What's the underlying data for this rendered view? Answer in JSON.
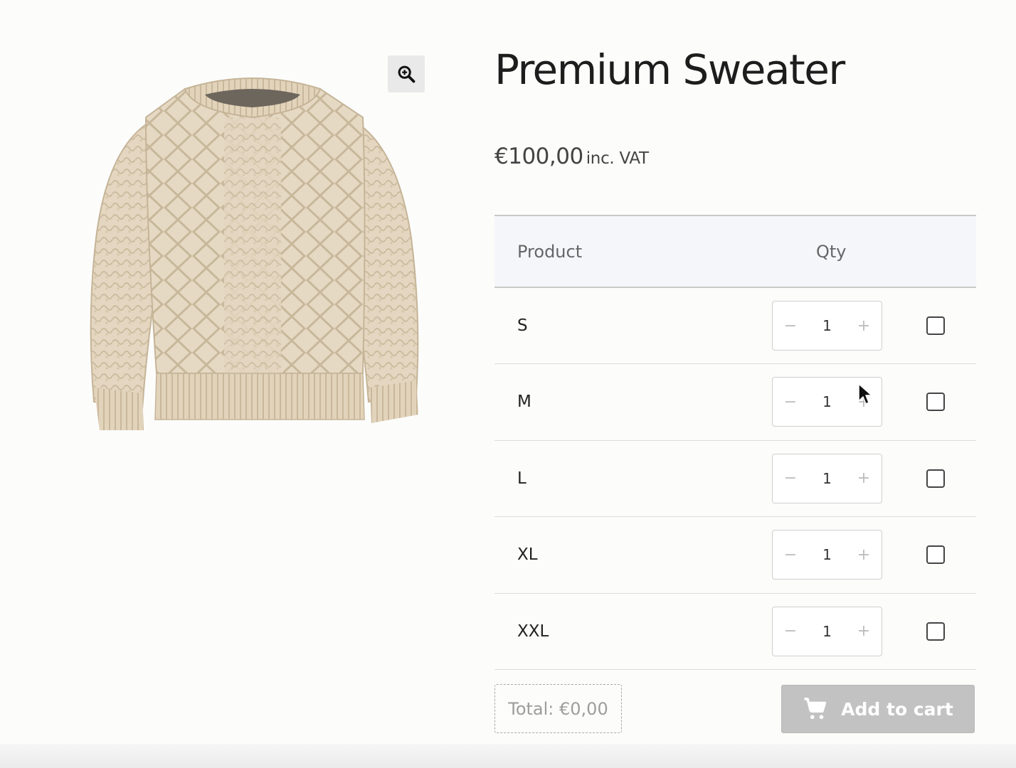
{
  "product": {
    "title": "Premium Sweater",
    "price": "€100,00",
    "price_suffix": "inc. VAT",
    "image_alt": "cream cable-knit sweater",
    "zoom_icon": "zoom-in-icon"
  },
  "variant_table": {
    "columns": [
      "Product",
      "Qty"
    ],
    "rows": [
      {
        "size": "S",
        "qty": "1",
        "checked": false
      },
      {
        "size": "M",
        "qty": "1",
        "checked": false
      },
      {
        "size": "L",
        "qty": "1",
        "checked": false
      },
      {
        "size": "XL",
        "qty": "1",
        "checked": false
      },
      {
        "size": "XXL",
        "qty": "1",
        "checked": false
      }
    ],
    "minus_symbol": "−",
    "plus_symbol": "+"
  },
  "footer": {
    "total_label": "Total: €0,00",
    "add_to_cart_label": "Add to cart",
    "cart_icon": "cart-icon"
  },
  "colors": {
    "sweater": "#e3d5bf",
    "button_disabled": "#c2c2c2",
    "header_bg": "#f5f6fa"
  }
}
